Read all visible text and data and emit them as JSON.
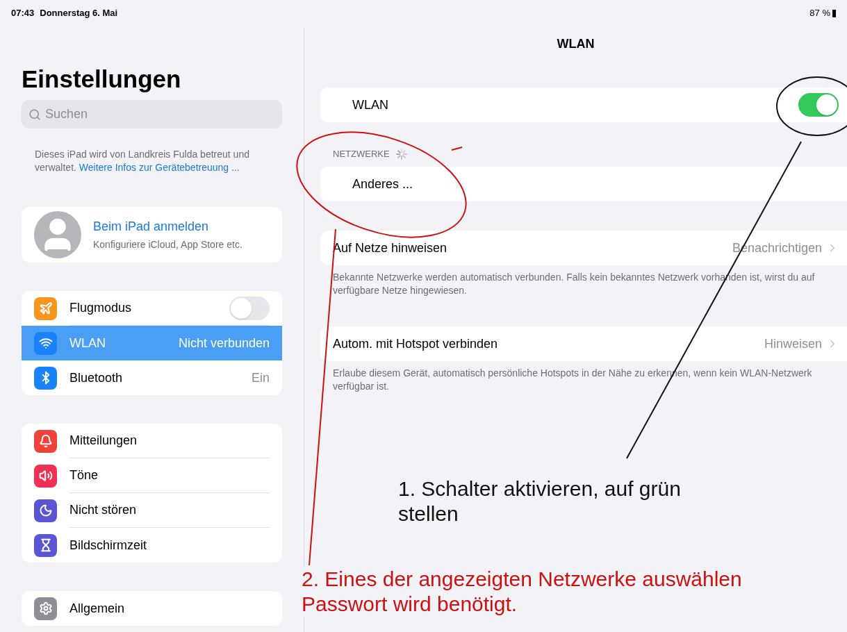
{
  "status_bar": {
    "time": "07:43",
    "date": "Donnerstag 6. Mai",
    "battery": "87 %"
  },
  "sidebar": {
    "title": "Einstellungen",
    "search": {
      "placeholder": "Suchen"
    },
    "management_note": {
      "text": "Dieses iPad wird von Landkreis Fulda betreut und verwaltet.",
      "link": "Weitere Infos zur Gerätebetreuung ..."
    },
    "account": {
      "title": "Beim iPad anmelden",
      "subtitle": "Konfiguriere iCloud, App Store etc."
    },
    "groups": [
      {
        "items": [
          {
            "kind": "toggle",
            "label": "Flugmodus",
            "on": false,
            "selected": false,
            "color": "#f7961e"
          },
          {
            "kind": "value",
            "label": "WLAN",
            "value": "Nicht verbunden",
            "selected": true,
            "color": "#1a82fb"
          },
          {
            "kind": "value",
            "label": "Bluetooth",
            "value": "Ein",
            "selected": false,
            "color": "#1a82fb"
          }
        ]
      },
      {
        "items": [
          {
            "kind": "plain",
            "label": "Mitteilungen",
            "selected": false,
            "color": "#f0413a"
          },
          {
            "kind": "plain",
            "label": "Töne",
            "selected": false,
            "color": "#f22f55"
          },
          {
            "kind": "plain",
            "label": "Nicht stören",
            "selected": false,
            "color": "#5b55d6"
          },
          {
            "kind": "plain",
            "label": "Bildschirmzeit",
            "selected": false,
            "color": "#5b55d6"
          }
        ]
      },
      {
        "items": [
          {
            "kind": "plain",
            "label": "Allgemein",
            "selected": false,
            "color": "#8e8e93"
          }
        ]
      }
    ]
  },
  "detail": {
    "title": "WLAN",
    "wifi": {
      "label": "WLAN",
      "on": true
    },
    "networks_header": "NETZWERKE",
    "networks": [
      {
        "label": "Anderes ..."
      }
    ],
    "settings": [
      {
        "label": "Auf Netze hinweisen",
        "value": "Benachrichtigen",
        "footer": "Bekannte Netzwerke werden automatisch verbunden. Falls kein bekanntes Netzwerk vorhanden ist, wirst du auf verfügbare Netze hingewiesen."
      },
      {
        "label": "Autom. mit Hotspot verbinden",
        "value": "Hinweisen",
        "footer": "Erlaube diesem Gerät, automatisch persönliche Hotspots in der Nähe zu erkennen, wenn kein WLAN-Netzwerk verfügbar ist."
      }
    ]
  },
  "annotations": [
    {
      "lines": [
        "1. Schalter aktivieren, auf grün stellen"
      ],
      "color": "#111111"
    },
    {
      "lines": [
        "2. Eines der angezeigten Netzwerke auswählen",
        "Passwort wird benötigt."
      ],
      "color": "#cc1111"
    }
  ]
}
